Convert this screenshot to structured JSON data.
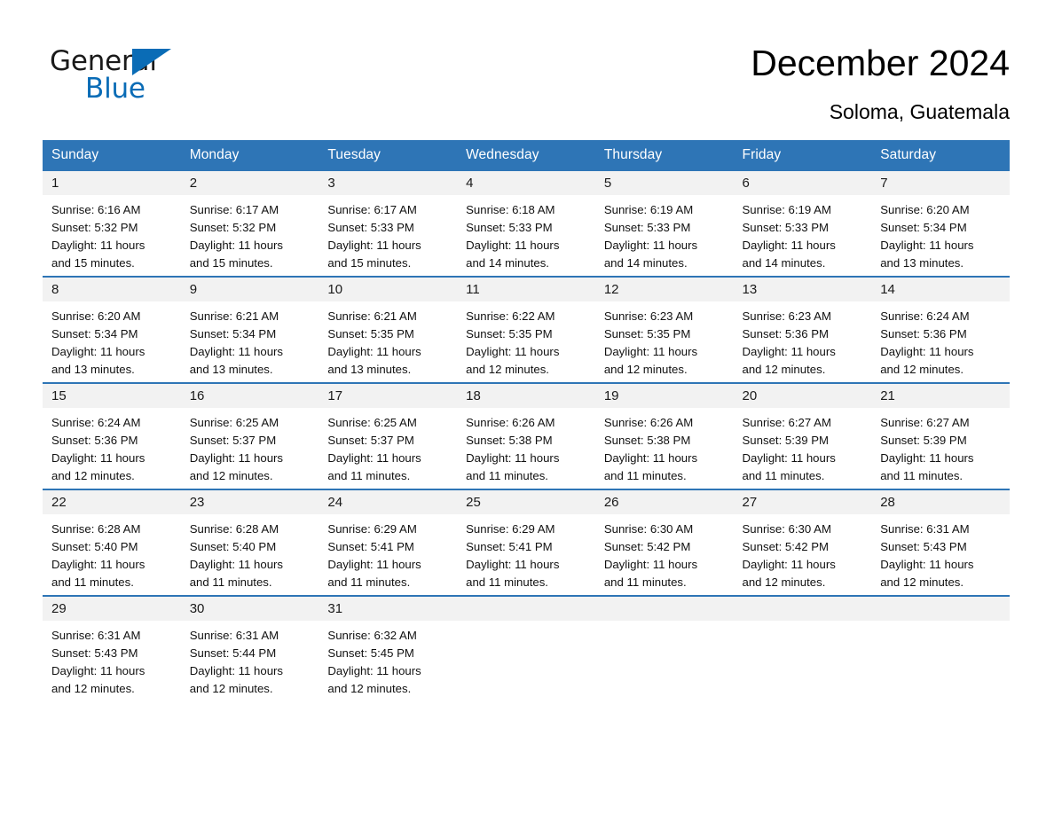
{
  "brand": {
    "name_part1": "General",
    "name_part2": "Blue",
    "triangle_icon": "triangle-icon",
    "accent_color": "#0a6cb6"
  },
  "header": {
    "title": "December 2024",
    "subtitle": "Soloma, Guatemala"
  },
  "theme": {
    "header_blue": "#2e75b6",
    "row_divider_blue": "#2e75b6",
    "daynum_band_gray": "#f2f2f2",
    "text_black": "#111111"
  },
  "calendar": {
    "weekday_headers": [
      "Sunday",
      "Monday",
      "Tuesday",
      "Wednesday",
      "Thursday",
      "Friday",
      "Saturday"
    ],
    "labels": {
      "sunrise_prefix": "Sunrise:",
      "sunset_prefix": "Sunset:",
      "daylight_prefix": "Daylight:"
    },
    "weeks": [
      [
        {
          "day": "1",
          "sunrise": "Sunrise: 6:16 AM",
          "sunset": "Sunset: 5:32 PM",
          "daylight_line1": "Daylight: 11 hours",
          "daylight_line2": "and 15 minutes."
        },
        {
          "day": "2",
          "sunrise": "Sunrise: 6:17 AM",
          "sunset": "Sunset: 5:32 PM",
          "daylight_line1": "Daylight: 11 hours",
          "daylight_line2": "and 15 minutes."
        },
        {
          "day": "3",
          "sunrise": "Sunrise: 6:17 AM",
          "sunset": "Sunset: 5:33 PM",
          "daylight_line1": "Daylight: 11 hours",
          "daylight_line2": "and 15 minutes."
        },
        {
          "day": "4",
          "sunrise": "Sunrise: 6:18 AM",
          "sunset": "Sunset: 5:33 PM",
          "daylight_line1": "Daylight: 11 hours",
          "daylight_line2": "and 14 minutes."
        },
        {
          "day": "5",
          "sunrise": "Sunrise: 6:19 AM",
          "sunset": "Sunset: 5:33 PM",
          "daylight_line1": "Daylight: 11 hours",
          "daylight_line2": "and 14 minutes."
        },
        {
          "day": "6",
          "sunrise": "Sunrise: 6:19 AM",
          "sunset": "Sunset: 5:33 PM",
          "daylight_line1": "Daylight: 11 hours",
          "daylight_line2": "and 14 minutes."
        },
        {
          "day": "7",
          "sunrise": "Sunrise: 6:20 AM",
          "sunset": "Sunset: 5:34 PM",
          "daylight_line1": "Daylight: 11 hours",
          "daylight_line2": "and 13 minutes."
        }
      ],
      [
        {
          "day": "8",
          "sunrise": "Sunrise: 6:20 AM",
          "sunset": "Sunset: 5:34 PM",
          "daylight_line1": "Daylight: 11 hours",
          "daylight_line2": "and 13 minutes."
        },
        {
          "day": "9",
          "sunrise": "Sunrise: 6:21 AM",
          "sunset": "Sunset: 5:34 PM",
          "daylight_line1": "Daylight: 11 hours",
          "daylight_line2": "and 13 minutes."
        },
        {
          "day": "10",
          "sunrise": "Sunrise: 6:21 AM",
          "sunset": "Sunset: 5:35 PM",
          "daylight_line1": "Daylight: 11 hours",
          "daylight_line2": "and 13 minutes."
        },
        {
          "day": "11",
          "sunrise": "Sunrise: 6:22 AM",
          "sunset": "Sunset: 5:35 PM",
          "daylight_line1": "Daylight: 11 hours",
          "daylight_line2": "and 12 minutes."
        },
        {
          "day": "12",
          "sunrise": "Sunrise: 6:23 AM",
          "sunset": "Sunset: 5:35 PM",
          "daylight_line1": "Daylight: 11 hours",
          "daylight_line2": "and 12 minutes."
        },
        {
          "day": "13",
          "sunrise": "Sunrise: 6:23 AM",
          "sunset": "Sunset: 5:36 PM",
          "daylight_line1": "Daylight: 11 hours",
          "daylight_line2": "and 12 minutes."
        },
        {
          "day": "14",
          "sunrise": "Sunrise: 6:24 AM",
          "sunset": "Sunset: 5:36 PM",
          "daylight_line1": "Daylight: 11 hours",
          "daylight_line2": "and 12 minutes."
        }
      ],
      [
        {
          "day": "15",
          "sunrise": "Sunrise: 6:24 AM",
          "sunset": "Sunset: 5:36 PM",
          "daylight_line1": "Daylight: 11 hours",
          "daylight_line2": "and 12 minutes."
        },
        {
          "day": "16",
          "sunrise": "Sunrise: 6:25 AM",
          "sunset": "Sunset: 5:37 PM",
          "daylight_line1": "Daylight: 11 hours",
          "daylight_line2": "and 12 minutes."
        },
        {
          "day": "17",
          "sunrise": "Sunrise: 6:25 AM",
          "sunset": "Sunset: 5:37 PM",
          "daylight_line1": "Daylight: 11 hours",
          "daylight_line2": "and 11 minutes."
        },
        {
          "day": "18",
          "sunrise": "Sunrise: 6:26 AM",
          "sunset": "Sunset: 5:38 PM",
          "daylight_line1": "Daylight: 11 hours",
          "daylight_line2": "and 11 minutes."
        },
        {
          "day": "19",
          "sunrise": "Sunrise: 6:26 AM",
          "sunset": "Sunset: 5:38 PM",
          "daylight_line1": "Daylight: 11 hours",
          "daylight_line2": "and 11 minutes."
        },
        {
          "day": "20",
          "sunrise": "Sunrise: 6:27 AM",
          "sunset": "Sunset: 5:39 PM",
          "daylight_line1": "Daylight: 11 hours",
          "daylight_line2": "and 11 minutes."
        },
        {
          "day": "21",
          "sunrise": "Sunrise: 6:27 AM",
          "sunset": "Sunset: 5:39 PM",
          "daylight_line1": "Daylight: 11 hours",
          "daylight_line2": "and 11 minutes."
        }
      ],
      [
        {
          "day": "22",
          "sunrise": "Sunrise: 6:28 AM",
          "sunset": "Sunset: 5:40 PM",
          "daylight_line1": "Daylight: 11 hours",
          "daylight_line2": "and 11 minutes."
        },
        {
          "day": "23",
          "sunrise": "Sunrise: 6:28 AM",
          "sunset": "Sunset: 5:40 PM",
          "daylight_line1": "Daylight: 11 hours",
          "daylight_line2": "and 11 minutes."
        },
        {
          "day": "24",
          "sunrise": "Sunrise: 6:29 AM",
          "sunset": "Sunset: 5:41 PM",
          "daylight_line1": "Daylight: 11 hours",
          "daylight_line2": "and 11 minutes."
        },
        {
          "day": "25",
          "sunrise": "Sunrise: 6:29 AM",
          "sunset": "Sunset: 5:41 PM",
          "daylight_line1": "Daylight: 11 hours",
          "daylight_line2": "and 11 minutes."
        },
        {
          "day": "26",
          "sunrise": "Sunrise: 6:30 AM",
          "sunset": "Sunset: 5:42 PM",
          "daylight_line1": "Daylight: 11 hours",
          "daylight_line2": "and 11 minutes."
        },
        {
          "day": "27",
          "sunrise": "Sunrise: 6:30 AM",
          "sunset": "Sunset: 5:42 PM",
          "daylight_line1": "Daylight: 11 hours",
          "daylight_line2": "and 12 minutes."
        },
        {
          "day": "28",
          "sunrise": "Sunrise: 6:31 AM",
          "sunset": "Sunset: 5:43 PM",
          "daylight_line1": "Daylight: 11 hours",
          "daylight_line2": "and 12 minutes."
        }
      ],
      [
        {
          "day": "29",
          "sunrise": "Sunrise: 6:31 AM",
          "sunset": "Sunset: 5:43 PM",
          "daylight_line1": "Daylight: 11 hours",
          "daylight_line2": "and 12 minutes."
        },
        {
          "day": "30",
          "sunrise": "Sunrise: 6:31 AM",
          "sunset": "Sunset: 5:44 PM",
          "daylight_line1": "Daylight: 11 hours",
          "daylight_line2": "and 12 minutes."
        },
        {
          "day": "31",
          "sunrise": "Sunrise: 6:32 AM",
          "sunset": "Sunset: 5:45 PM",
          "daylight_line1": "Daylight: 11 hours",
          "daylight_line2": "and 12 minutes."
        },
        {
          "day": "",
          "sunrise": "",
          "sunset": "",
          "daylight_line1": "",
          "daylight_line2": ""
        },
        {
          "day": "",
          "sunrise": "",
          "sunset": "",
          "daylight_line1": "",
          "daylight_line2": ""
        },
        {
          "day": "",
          "sunrise": "",
          "sunset": "",
          "daylight_line1": "",
          "daylight_line2": ""
        },
        {
          "day": "",
          "sunrise": "",
          "sunset": "",
          "daylight_line1": "",
          "daylight_line2": ""
        }
      ]
    ]
  }
}
